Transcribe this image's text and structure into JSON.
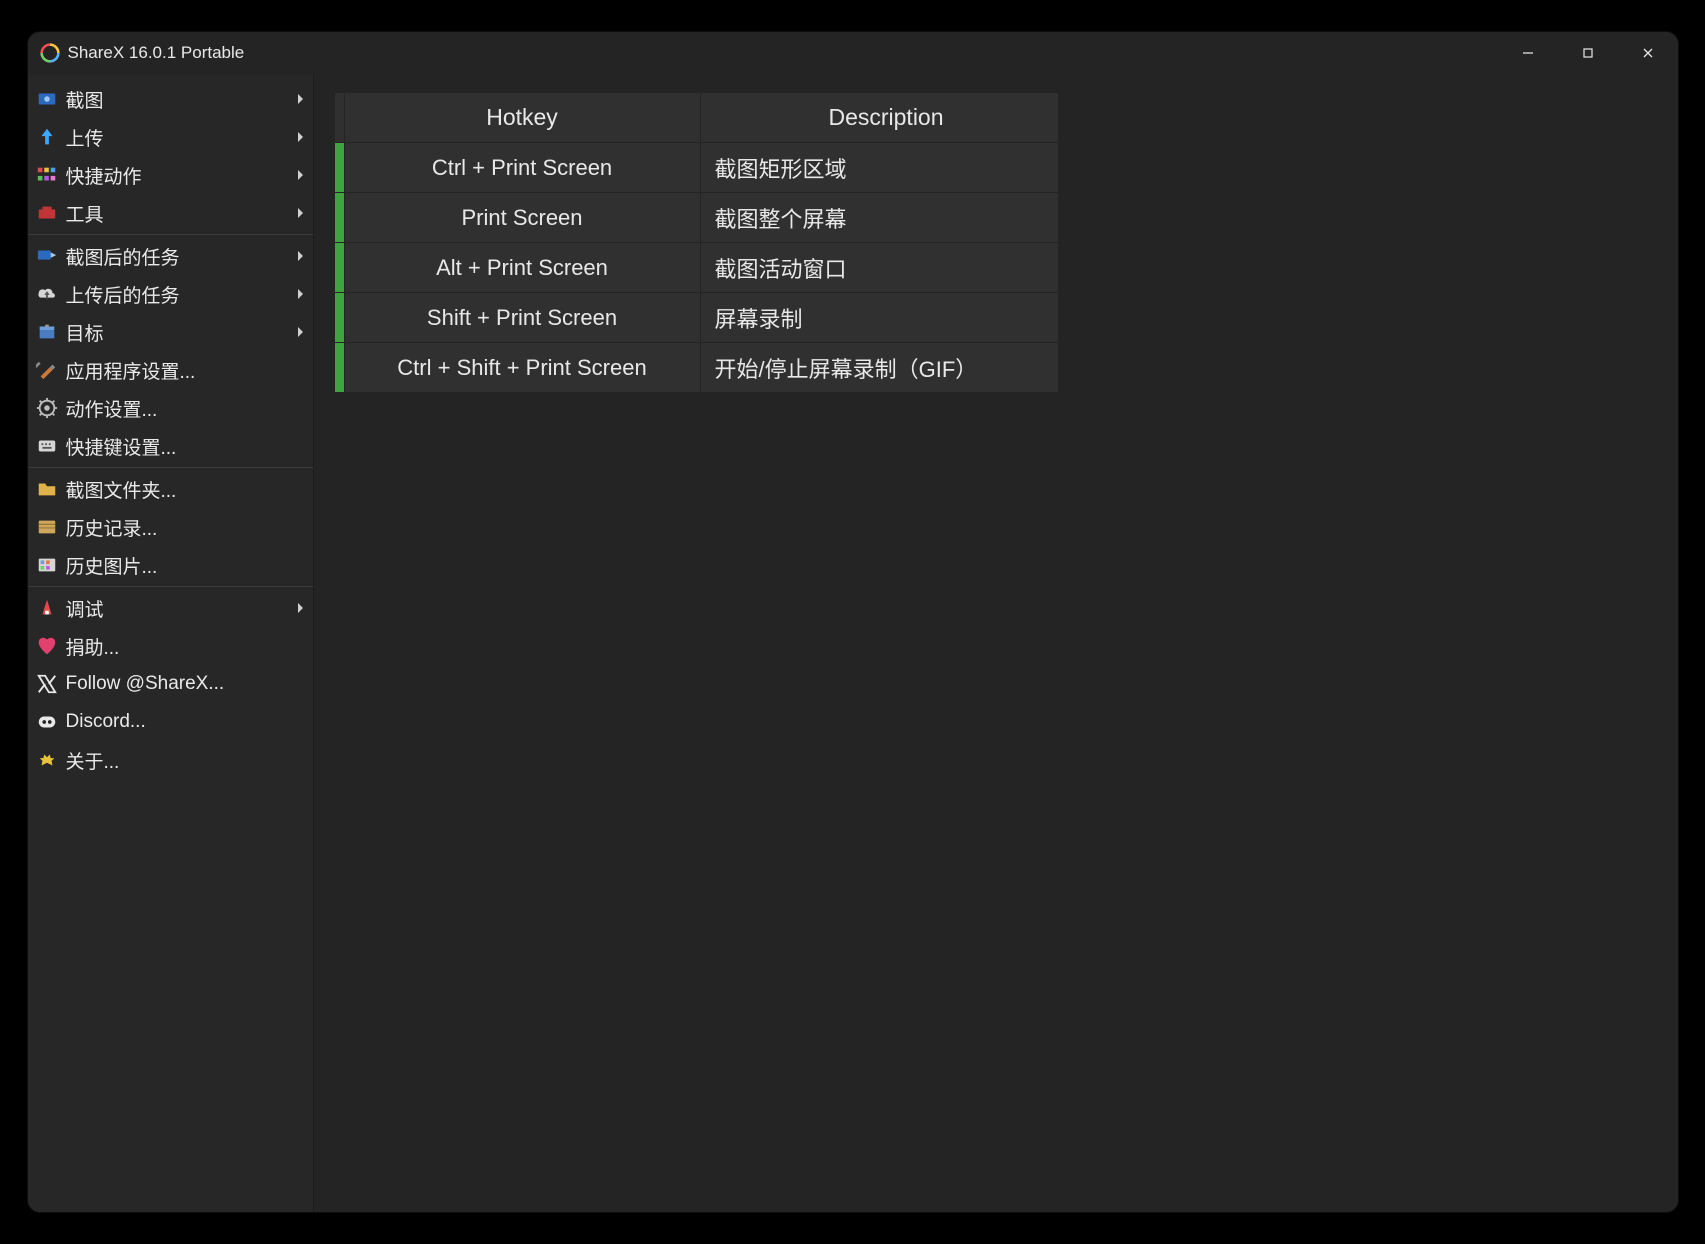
{
  "window": {
    "title": "ShareX 16.0.1 Portable"
  },
  "sidebar": {
    "groups": [
      {
        "items": [
          {
            "id": "capture",
            "icon": "capture-icon",
            "label": "截图",
            "submenu": true
          },
          {
            "id": "upload",
            "icon": "upload-icon",
            "label": "上传",
            "submenu": true
          },
          {
            "id": "workflow",
            "icon": "workflow-icon",
            "label": "快捷动作",
            "submenu": true
          },
          {
            "id": "tools",
            "icon": "tools-icon",
            "label": "工具",
            "submenu": true
          }
        ]
      },
      {
        "items": [
          {
            "id": "after-capture",
            "icon": "after-capture-icon",
            "label": "截图后的任务",
            "submenu": true
          },
          {
            "id": "after-upload",
            "icon": "after-upload-icon",
            "label": "上传后的任务",
            "submenu": true
          },
          {
            "id": "destinations",
            "icon": "destinations-icon",
            "label": "目标",
            "submenu": true
          },
          {
            "id": "app-settings",
            "icon": "app-settings-icon",
            "label": "应用程序设置...",
            "submenu": false
          },
          {
            "id": "task-settings",
            "icon": "task-settings-icon",
            "label": "动作设置...",
            "submenu": false
          },
          {
            "id": "hotkey-settings",
            "icon": "hotkey-settings-icon",
            "label": "快捷键设置...",
            "submenu": false
          }
        ]
      },
      {
        "items": [
          {
            "id": "screenshots-folder",
            "icon": "folder-icon",
            "label": "截图文件夹...",
            "submenu": false
          },
          {
            "id": "history",
            "icon": "history-icon",
            "label": "历史记录...",
            "submenu": false
          },
          {
            "id": "image-history",
            "icon": "image-history-icon",
            "label": "历史图片...",
            "submenu": false
          }
        ]
      },
      {
        "items": [
          {
            "id": "debug",
            "icon": "debug-icon",
            "label": "调试",
            "submenu": true
          },
          {
            "id": "donate",
            "icon": "donate-icon",
            "label": "捐助...",
            "submenu": false
          },
          {
            "id": "twitter",
            "icon": "twitter-icon",
            "label": "Follow @ShareX...",
            "submenu": false
          },
          {
            "id": "discord",
            "icon": "discord-icon",
            "label": "Discord...",
            "submenu": false
          },
          {
            "id": "about",
            "icon": "about-icon",
            "label": "关于...",
            "submenu": false
          }
        ]
      }
    ]
  },
  "hotkeys": {
    "headers": {
      "hotkey": "Hotkey",
      "description": "Description"
    },
    "rows": [
      {
        "hotkey": "Ctrl + Print Screen",
        "description": "截图矩形区域"
      },
      {
        "hotkey": "Print Screen",
        "description": "截图整个屏幕"
      },
      {
        "hotkey": "Alt + Print Screen",
        "description": "截图活动窗口"
      },
      {
        "hotkey": "Shift + Print Screen",
        "description": "屏幕录制"
      },
      {
        "hotkey": "Ctrl + Shift + Print Screen",
        "description": "开始/停止屏幕录制（GIF）"
      }
    ]
  }
}
